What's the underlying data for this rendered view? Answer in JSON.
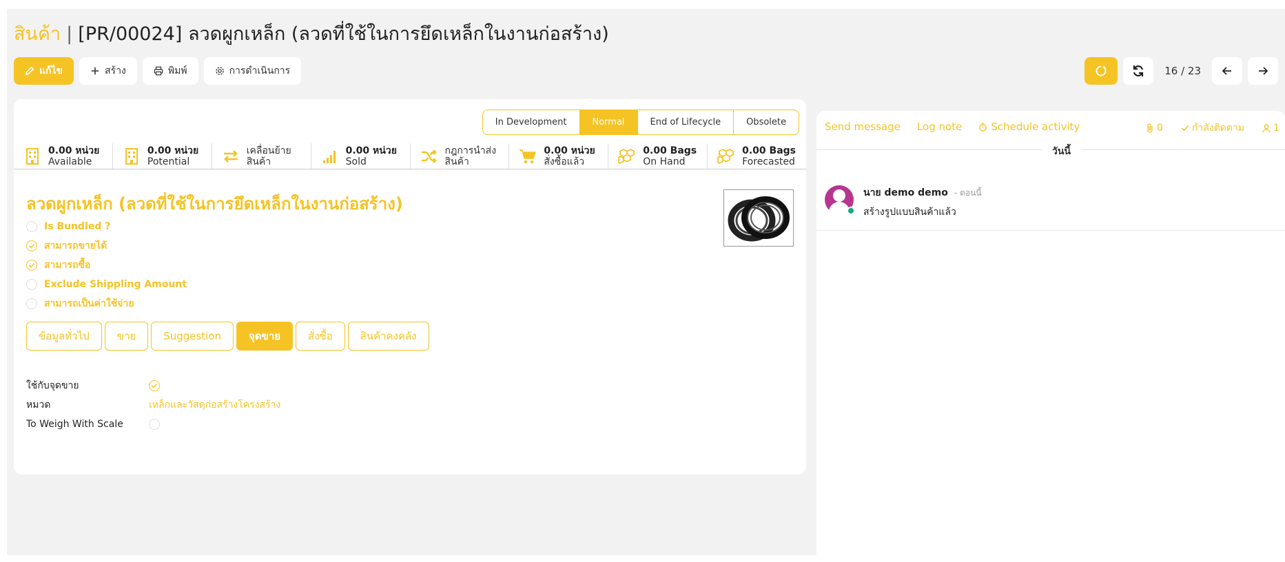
{
  "breadcrumb": {
    "root": "สินค้า",
    "separator": "|",
    "current": "[PR/00024] ลวดผูกเหล็ก (ลวดที่ใช้ในการยึดเหล็กในงานก่อสร้าง)"
  },
  "toolbar": {
    "edit": "แก้ไข",
    "create": "สร้าง",
    "print": "พิมพ์",
    "action": "การดำเนินการ"
  },
  "pager": {
    "count": "16 / 23"
  },
  "status_stages": [
    {
      "label": "In Development",
      "active": false
    },
    {
      "label": "Normal",
      "active": true
    },
    {
      "label": "End of Lifecycle",
      "active": false
    },
    {
      "label": "Obsolete",
      "active": false
    }
  ],
  "stats": [
    {
      "icon": "building-icon",
      "value": "0.00 หน่วย",
      "label": "Available"
    },
    {
      "icon": "building-icon",
      "value": "0.00 หน่วย",
      "label": "Potential"
    },
    {
      "icon": "transfer-arrows-icon",
      "value": "เคลื่อนย้าย",
      "label": "สินค้า"
    },
    {
      "icon": "signal-bars-icon",
      "value": "0.00 หน่วย",
      "label": "Sold"
    },
    {
      "icon": "shuffle-icon",
      "value": "กฎการนำส่ง",
      "label": "สินค้า"
    },
    {
      "icon": "cart-icon",
      "value": "0.00 หน่วย",
      "label": "สั่งซื้อแล้ว"
    },
    {
      "icon": "cubes-icon",
      "value": "0.00 Bags",
      "label": "On Hand"
    },
    {
      "icon": "cubes-icon",
      "value": "0.00 Bags",
      "label": "Forecasted"
    }
  ],
  "product": {
    "title": "ลวดผูกเหล็ก (ลวดที่ใช้ในการยึดเหล็กในงานก่อสร้าง)",
    "options": [
      {
        "label": "Is Bundled ?",
        "checked": false
      },
      {
        "label": "สามารถขายได้",
        "checked": true
      },
      {
        "label": "สามารถซื้อ",
        "checked": true
      },
      {
        "label": "Exclude Shippling Amount",
        "checked": false
      },
      {
        "label": "สามารถเป็นค่าใช้จ่าย",
        "checked": false
      }
    ]
  },
  "tabs": [
    {
      "label": "ข้อมูลทั่วไป",
      "active": false
    },
    {
      "label": "ขาย",
      "active": false
    },
    {
      "label": "Suggestion",
      "active": false
    },
    {
      "label": "จุดขาย",
      "active": true
    },
    {
      "label": "สั่งซื้อ",
      "active": false
    },
    {
      "label": "สินค้าคงคลัง",
      "active": false
    }
  ],
  "fields": {
    "pos_label": "ใช้กับจุดขาย",
    "pos_checked": true,
    "category_label": "หมวด",
    "category_value": "เหล็กและวัสดุก่อสร้างโครงสร้าง",
    "scale_label": "To Weigh With Scale",
    "scale_checked": false
  },
  "chatter": {
    "send_message": "Send message",
    "log_note": "Log note",
    "schedule_activity": "Schedule activity",
    "attachments": "0",
    "following": "กำลังติดตาม",
    "followers": "1",
    "day": "วันนี้",
    "message": {
      "author": "นาย demo demo",
      "time": "- ตอนนี้",
      "body": "สร้างรูปแบบสินค้าแล้ว"
    }
  },
  "colors": {
    "accent": "#f5c324",
    "online": "#17a589",
    "avatar": "#b8358e"
  }
}
